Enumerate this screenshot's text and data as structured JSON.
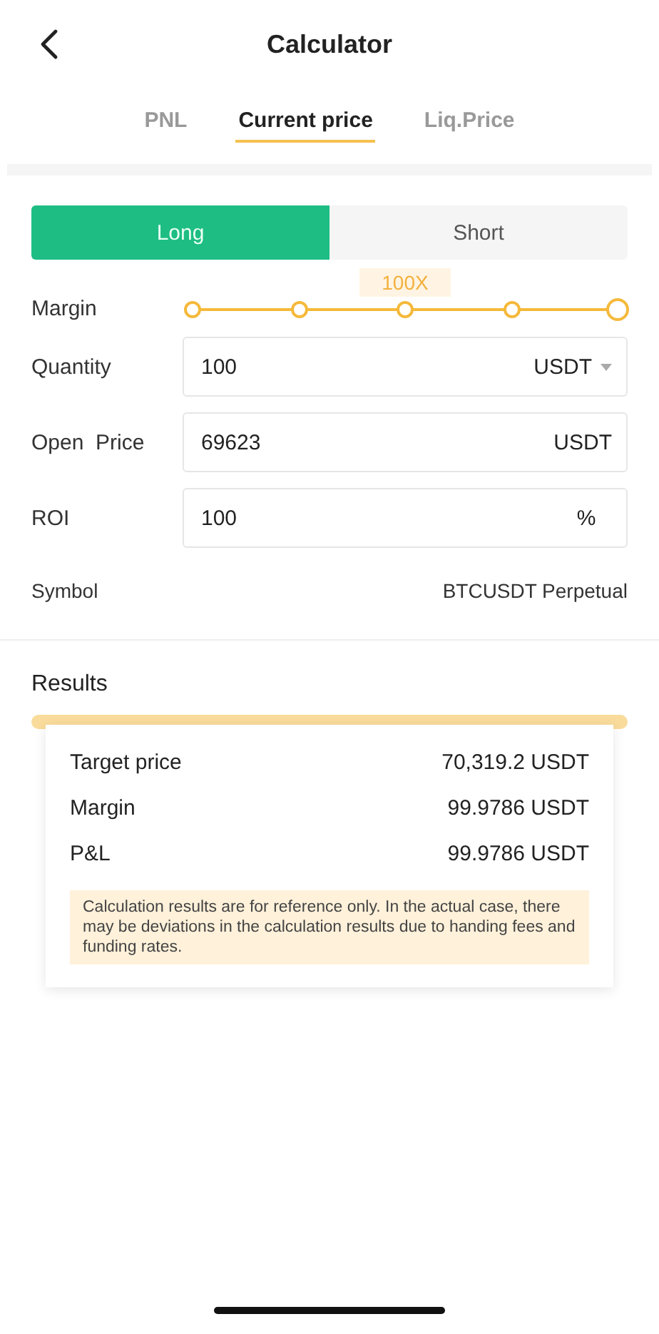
{
  "header": {
    "title": "Calculator"
  },
  "tabs": [
    {
      "label": "PNL",
      "selected": false
    },
    {
      "label": "Current price",
      "selected": true
    },
    {
      "label": "Liq.Price",
      "selected": false
    }
  ],
  "side": [
    {
      "label": "Long",
      "selected": true
    },
    {
      "label": "Short",
      "selected": false
    }
  ],
  "margin": {
    "label": "Margin",
    "tooltip": "100X",
    "level": 1
  },
  "fields": [
    {
      "label": "Quantity",
      "value": "100",
      "unit": "USDT",
      "kind": "dropdown"
    },
    {
      "label": "Open  Price",
      "value": "69623",
      "unit": "USDT",
      "kind": "plain"
    },
    {
      "label": "ROI",
      "value": "100",
      "unit": "%",
      "kind": "plain"
    }
  ],
  "symbol": {
    "label": "Symbol",
    "value": "BTCUSDT Perpetual"
  },
  "results": {
    "title": "Results",
    "rows": [
      {
        "label": "Target price",
        "value": "70,319.2 USDT"
      },
      {
        "label": "Margin",
        "value": "99.9786 USDT"
      },
      {
        "label": "P&L",
        "value": "99.9786 USDT"
      }
    ],
    "note": "Calculation results are for reference only. In the actual case, there may be deviations in the calculation results due to handing fees and funding rates."
  }
}
